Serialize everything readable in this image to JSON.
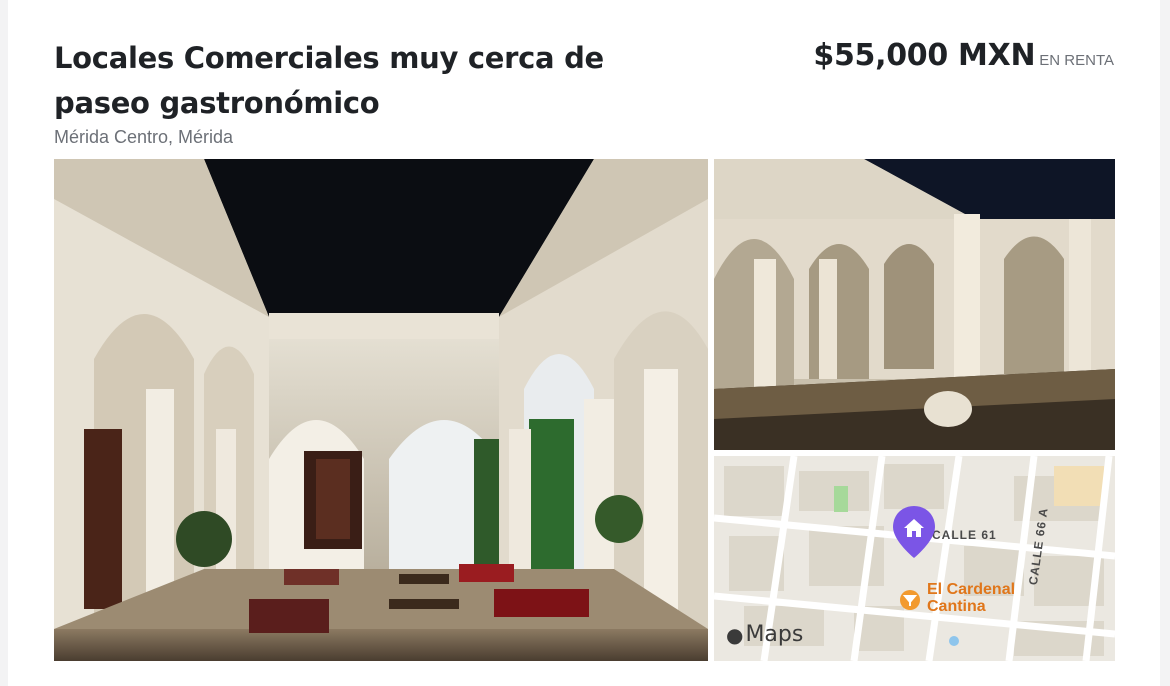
{
  "listing": {
    "title": "Locales Comerciales muy cerca de paseo gastronómico",
    "location": "Mérida Centro, Mérida",
    "price": "$55,000 MXN",
    "operation": "EN RENTA"
  },
  "map": {
    "street_1": "CALLE 61",
    "street_2": "CALLE 66 A",
    "poi_name": "El Cardenal\nCantina",
    "brand": "Maps",
    "home_icon": "home-icon",
    "poi_icon": "restaurant-icon",
    "brand_icon": "apple-icon"
  },
  "colors": {
    "title": "#1f2226",
    "secondary": "#6c7077",
    "map_pin": "#7b55e6",
    "poi": "#e0761a"
  }
}
